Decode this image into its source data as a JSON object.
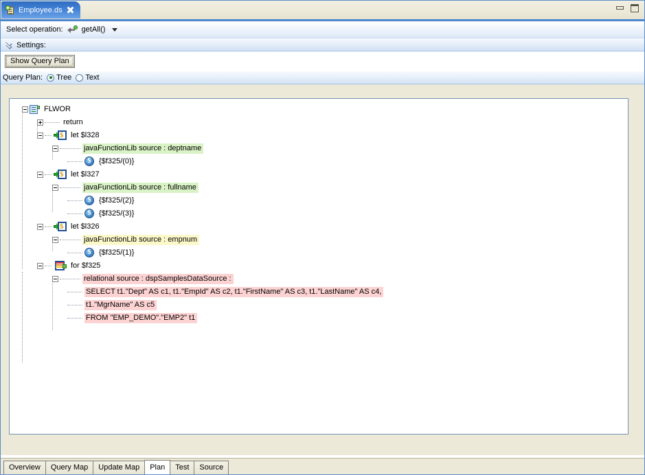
{
  "window": {
    "tab_title": "Employee.ds",
    "tab_icon": "document-add-icon",
    "close_icon": "close-icon",
    "minimize_icon": "minimize-icon",
    "maximize_icon": "maximize-icon"
  },
  "toolbar": {
    "select_operation_label": "Select operation:",
    "operation_value": "getAll()",
    "operation_icon": "operation-arrow-icon",
    "dropdown_icon": "chevron-down-icon"
  },
  "settings": {
    "label": "Settings:",
    "expander_icon": "double-chevron-down-icon",
    "show_query_plan_label": "Show Query Plan"
  },
  "query_plan": {
    "label": "Query Plan:",
    "options": [
      {
        "label": "Tree",
        "checked": true
      },
      {
        "label": "Text",
        "checked": false
      }
    ]
  },
  "tree": {
    "root": {
      "label": "FLWOR",
      "icon": "flwor-icon",
      "expander": "minus"
    },
    "nodes": [
      {
        "label": "return",
        "expander": "plus",
        "icon": "none",
        "highlight": "none"
      },
      {
        "label": "let $l328",
        "expander": "minus",
        "icon": "let-icon",
        "highlight": "none"
      },
      {
        "label": "javaFunctionLib source : deptname",
        "expander": "minus",
        "icon": "none",
        "highlight": "green"
      },
      {
        "label": "{$f325/(0)}",
        "expander": "none",
        "icon": "dollar-icon",
        "highlight": "none"
      },
      {
        "label": "let $l327",
        "expander": "minus",
        "icon": "let-icon",
        "highlight": "none"
      },
      {
        "label": "javaFunctionLib source : fullname",
        "expander": "minus",
        "icon": "none",
        "highlight": "green"
      },
      {
        "label": "{$f325/(2)}",
        "expander": "none",
        "icon": "dollar-icon",
        "highlight": "none"
      },
      {
        "label": "{$f325/(3)}",
        "expander": "none",
        "icon": "dollar-icon",
        "highlight": "none"
      },
      {
        "label": "let $l326",
        "expander": "minus",
        "icon": "let-icon",
        "highlight": "none"
      },
      {
        "label": "javaFunctionLib source : empnum",
        "expander": "minus",
        "icon": "none",
        "highlight": "yellow"
      },
      {
        "label": "{$f325/(1)}",
        "expander": "none",
        "icon": "dollar-icon",
        "highlight": "none"
      },
      {
        "label": "for $f325",
        "expander": "minus",
        "icon": "for-icon",
        "highlight": "none"
      },
      {
        "label": "relational source : dspSamplesDataSource :",
        "expander": "minus",
        "icon": "none",
        "highlight": "red"
      },
      {
        "label": "SELECT t1.\"Dept\" AS c1, t1.\"EmpId\" AS c2, t1.\"FirstName\" AS c3, t1.\"LastName\" AS c4,",
        "expander": "none",
        "icon": "none",
        "highlight": "red"
      },
      {
        "label": "t1.\"MgrName\" AS c5",
        "expander": "none",
        "icon": "none",
        "highlight": "red"
      },
      {
        "label": "FROM \"EMP_DEMO\".\"EMP2\" t1",
        "expander": "none",
        "icon": "none",
        "highlight": "red"
      }
    ]
  },
  "bottom_tabs": [
    {
      "label": "Overview",
      "active": false
    },
    {
      "label": "Query Map",
      "active": false
    },
    {
      "label": "Update Map",
      "active": false
    },
    {
      "label": "Plan",
      "active": true
    },
    {
      "label": "Test",
      "active": false
    },
    {
      "label": "Source",
      "active": false
    }
  ],
  "colors": {
    "accent_blue": "#4a86cf",
    "tab_gradient_start": "#2e6cc0",
    "highlight_green": "#d9f2c6",
    "highlight_yellow": "#fbf8c9",
    "highlight_red": "#fcd2d2",
    "panel_border": "#7393b4"
  }
}
